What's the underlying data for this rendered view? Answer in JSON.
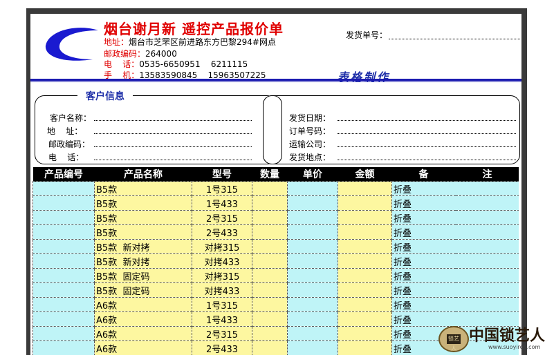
{
  "header": {
    "title": "烟台谢月新  遥控产品报价单",
    "address_label": "地址：",
    "address": "烟台市芝罘区前进路东方巴黎294#网点",
    "postcode_label": "邮政编码：",
    "postcode": "264000",
    "phone_label": "电    话：",
    "phone": "0535-6650951    6211115",
    "mobile_label": "手    机：",
    "mobile": "13583590845    15963507225",
    "ship_no_label": "发货单号：",
    "maker": "表格制作"
  },
  "customer": {
    "title": "客户信息",
    "name_label": "客户名称：",
    "address_label": "地    址：",
    "postcode_label": "邮政编码：",
    "phone_label": "电    话："
  },
  "shipping": {
    "date_label": "发货日期：",
    "order_label": "订单号码：",
    "carrier_label": "运输公司：",
    "place_label": "发货地点："
  },
  "table": {
    "headers": [
      "产品编号",
      "产品名称",
      "型号",
      "数量",
      "单价",
      "金额",
      "备",
      "注"
    ],
    "rows": [
      {
        "name": "B5款",
        "model": "1号315",
        "note": "折叠"
      },
      {
        "name": "B5款",
        "model": "1号433",
        "note": "折叠"
      },
      {
        "name": "B5款",
        "model": "2号315",
        "note": "折叠"
      },
      {
        "name": "B5款",
        "model": "2号433",
        "note": "折叠"
      },
      {
        "name": "B5款  新对拷",
        "model": "对拷315",
        "note": "折叠"
      },
      {
        "name": "B5款  新对拷",
        "model": "对拷433",
        "note": "折叠"
      },
      {
        "name": "B5款  固定码",
        "model": "对拷315",
        "note": "折叠"
      },
      {
        "name": "B5款  固定码",
        "model": "对拷433",
        "note": "折叠"
      },
      {
        "name": "A6款",
        "model": "1号315",
        "note": "折叠"
      },
      {
        "name": "A6款",
        "model": "1号433",
        "note": "折叠"
      },
      {
        "name": "A6款",
        "model": "2号315",
        "note": "折叠"
      },
      {
        "name": "A6款",
        "model": "2号433",
        "note": "折叠"
      }
    ]
  },
  "watermark": {
    "text": "中国锁艺人",
    "url": "www.suoyiren.com",
    "badge": "锁艺人"
  },
  "colors": {
    "title_red": "#e00000",
    "accent_blue": "#1e2fa8",
    "cell_cyan": "#bff4f7",
    "cell_yellow": "#fdf7a0",
    "header_black": "#000000"
  }
}
